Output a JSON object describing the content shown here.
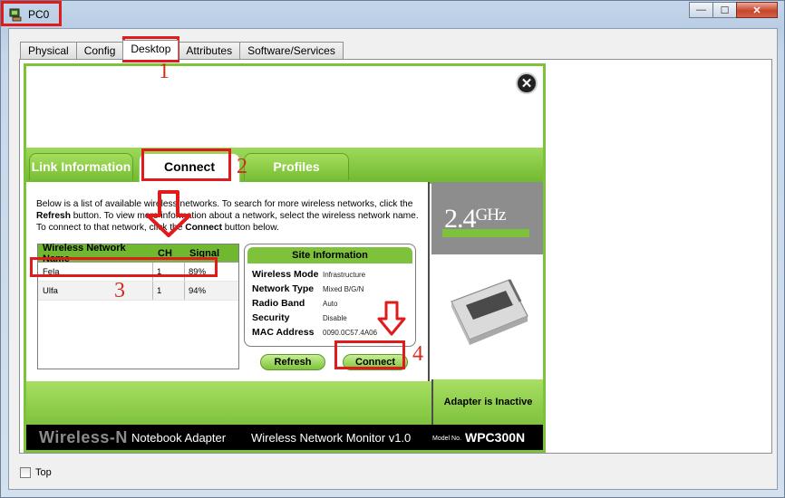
{
  "window": {
    "title": "PC0",
    "min_glyph": "—",
    "max_glyph": "☐",
    "close_glyph": "✕"
  },
  "tabs": [
    "Physical",
    "Config",
    "Desktop",
    "Attributes",
    "Software/Services"
  ],
  "active_tab": "Desktop",
  "app": {
    "tabs": {
      "link": "Link Information",
      "connect": "Connect",
      "profiles": "Profiles"
    },
    "intro": {
      "p1": "Below is a list of available wireless networks. To search for more wireless networks, click the ",
      "refresh_word": "Refresh",
      "p2": " button. To view more information about a network, select the wireless network name. To connect to that network, click the ",
      "connect_word": "Connect",
      "p3": " button below."
    },
    "networks": {
      "headers": [
        "Wireless Network Name",
        "CH",
        "Signal"
      ],
      "rows": [
        {
          "name": "Fela",
          "ch": "1",
          "signal": "89%"
        },
        {
          "name": "Ulfa",
          "ch": "1",
          "signal": "94%"
        }
      ]
    },
    "site_info": {
      "title": "Site Information",
      "rows": [
        {
          "label": "Wireless Mode",
          "value": "Infrastructure"
        },
        {
          "label": "Network Type",
          "value": "Mixed B/G/N"
        },
        {
          "label": "Radio Band",
          "value": "Auto"
        },
        {
          "label": "Security",
          "value": "Disable"
        },
        {
          "label": "MAC Address",
          "value": "0090.0C57.4A06"
        }
      ]
    },
    "buttons": {
      "refresh": "Refresh",
      "connect": "Connect"
    },
    "ghz": {
      "num": "2.4",
      "unit": "GHz"
    },
    "status": "Adapter is Inactive",
    "footer": {
      "brand": "Wireless-N",
      "brand_sub": "Notebook Adapter",
      "monitor": "Wireless Network Monitor  v1.0",
      "model_label": "Model No.",
      "model": "WPC300N"
    },
    "close_glyph": "✕"
  },
  "top_checkbox": {
    "label": "Top",
    "checked": false
  },
  "annotations": [
    "1",
    "2",
    "3",
    "4"
  ],
  "colors": {
    "accent_green": "#7ec23c",
    "annotation_red": "#e01b1b"
  }
}
